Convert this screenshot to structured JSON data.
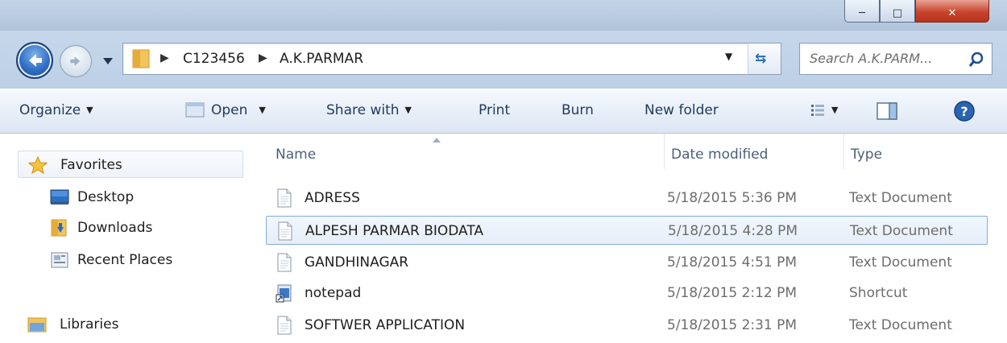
{
  "address": {
    "breadcrumbs": [
      "C123456",
      "A.K.PARMAR"
    ]
  },
  "search": {
    "placeholder": "Search A.K.PARM..."
  },
  "toolbar": {
    "organize": "Organize",
    "open": "Open",
    "share_with": "Share with",
    "print": "Print",
    "burn": "Burn",
    "new_folder": "New folder"
  },
  "sidebar": {
    "favorites": "Favorites",
    "items": [
      {
        "label": "Desktop",
        "icon": "desktop-icon"
      },
      {
        "label": "Downloads",
        "icon": "downloads-folder-icon"
      },
      {
        "label": "Recent Places",
        "icon": "recent-places-icon"
      }
    ],
    "libraries": "Libraries"
  },
  "columns": {
    "name": "Name",
    "date_modified": "Date modified",
    "type": "Type"
  },
  "files": [
    {
      "name": "ADRESS",
      "date": "5/18/2015 5:36 PM",
      "type": "Text Document",
      "icon": "text-document-icon",
      "selected": false
    },
    {
      "name": "ALPESH PARMAR BIODATA",
      "date": "5/18/2015 4:28 PM",
      "type": "Text Document",
      "icon": "text-document-icon",
      "selected": true
    },
    {
      "name": "GANDHINAGAR",
      "date": "5/18/2015 4:51 PM",
      "type": "Text Document",
      "icon": "text-document-icon",
      "selected": false
    },
    {
      "name": "notepad",
      "date": "5/18/2015 2:12 PM",
      "type": "Shortcut",
      "icon": "shortcut-icon",
      "selected": false
    },
    {
      "name": "SOFTWER APPLICATION",
      "date": "5/18/2015 2:31 PM",
      "type": "Text Document",
      "icon": "text-document-icon",
      "selected": false
    }
  ],
  "colors": {
    "selection_border": "#84acdd",
    "toolbar_text": "#1e3a5f",
    "header_text": "#4c607a",
    "meta_text": "#6d6d6d"
  }
}
